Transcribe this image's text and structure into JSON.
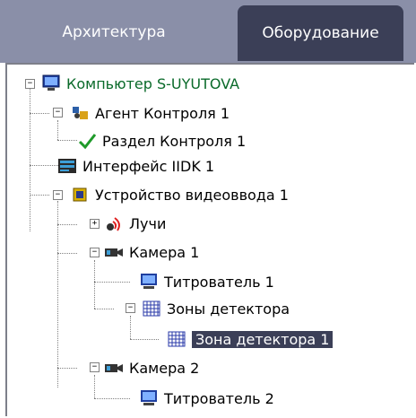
{
  "tabs": [
    {
      "label": "Архитектура",
      "active": false
    },
    {
      "label": "Оборудование",
      "active": true
    }
  ],
  "tree": {
    "computer": "Компьютер S-UYUTOVA",
    "agent": "Агент Контроля 1",
    "section": "Раздел Контроля 1",
    "interface": "Интерфейс IIDK 1",
    "video_device": "Устройство видеоввода 1",
    "rays": "Лучи",
    "camera1": "Камера 1",
    "titler1": "Титрователь 1",
    "zones": "Зоны детектора",
    "zone1": "Зона детектора 1",
    "camera2": "Камера 2",
    "titler2": "Титрователь 2"
  },
  "colors": {
    "selection": "#3b3f57",
    "tabbar": "#8a8fa8",
    "computer_text": "#0a6a2a"
  }
}
